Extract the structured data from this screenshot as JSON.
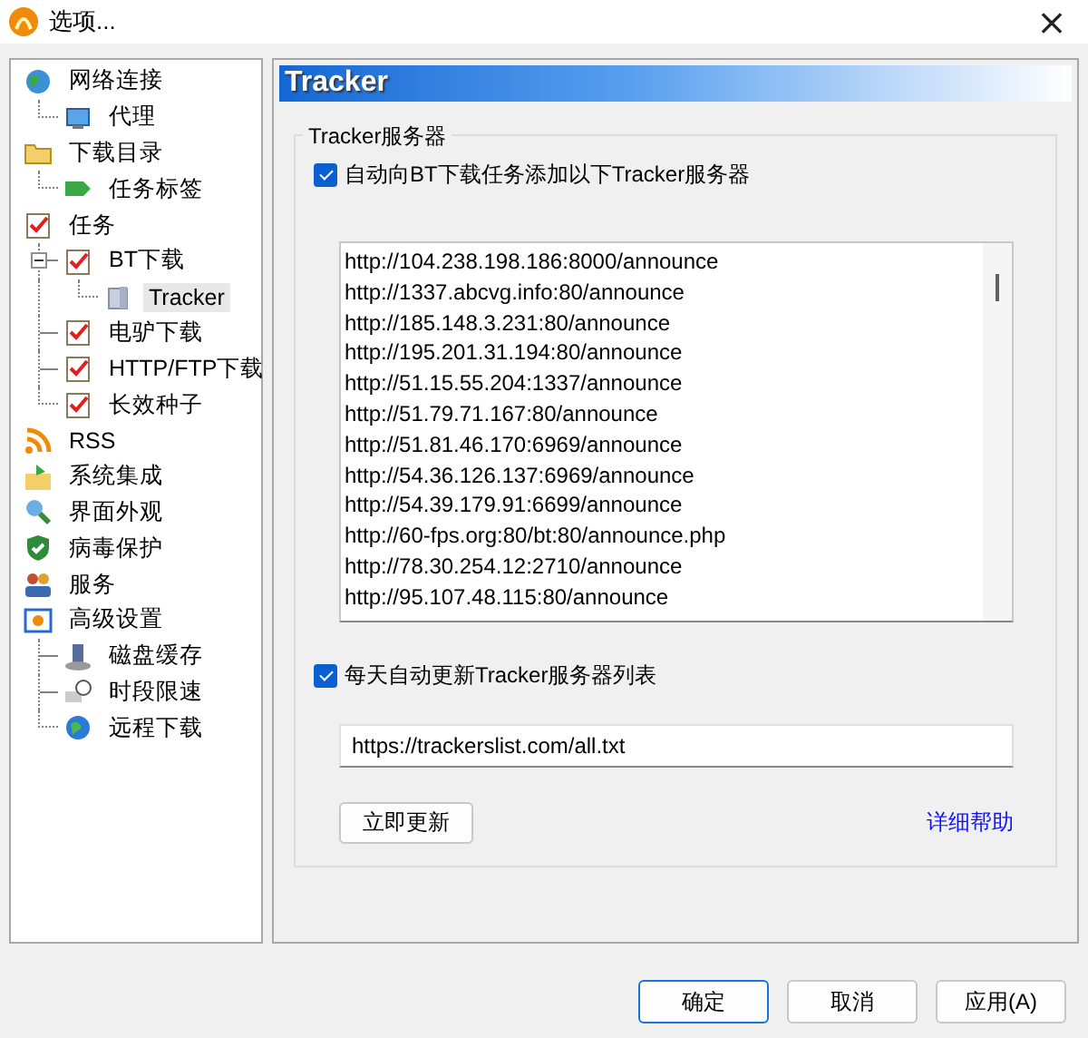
{
  "window": {
    "title": "选项...",
    "close": "×"
  },
  "tree": [
    {
      "label": "网络连接",
      "selected": false,
      "children": [
        {
          "label": "代理",
          "selected": false
        }
      ]
    },
    {
      "label": "下载目录",
      "selected": false,
      "children": [
        {
          "label": "任务标签",
          "selected": false
        }
      ]
    },
    {
      "label": "任务",
      "selected": false,
      "children": [
        {
          "label": "BT下载",
          "selected": false,
          "expanded": true,
          "children": [
            {
              "label": "Tracker",
              "selected": true
            }
          ]
        },
        {
          "label": "电驴下载",
          "selected": false
        },
        {
          "label": "HTTP/FTP下载",
          "selected": false
        },
        {
          "label": "长效种子",
          "selected": false
        }
      ]
    },
    {
      "label": "RSS",
      "selected": false
    },
    {
      "label": "系统集成",
      "selected": false
    },
    {
      "label": "界面外观",
      "selected": false
    },
    {
      "label": "病毒保护",
      "selected": false
    },
    {
      "label": "服务",
      "selected": false
    },
    {
      "label": "高级设置",
      "selected": false,
      "children": [
        {
          "label": "磁盘缓存",
          "selected": false
        },
        {
          "label": "时段限速",
          "selected": false
        },
        {
          "label": "远程下载",
          "selected": false
        }
      ]
    }
  ],
  "page": {
    "title": "Tracker",
    "group": {
      "title": "Tracker服务器",
      "auto_add": {
        "label": "自动向BT下载任务添加以下Tracker服务器",
        "checked": true
      },
      "trackers": [
        "http://104.238.198.186:8000/announce",
        "http://1337.abcvg.info:80/announce",
        "http://185.148.3.231:80/announce",
        "http://195.201.31.194:80/announce",
        "http://51.15.55.204:1337/announce",
        "http://51.79.71.167:80/announce",
        "http://51.81.46.170:6969/announce",
        "http://54.36.126.137:6969/announce",
        "http://54.39.179.91:6699/announce",
        "http://60-fps.org:80/bt:80/announce.php",
        "http://78.30.254.12:2710/announce",
        "http://95.107.48.115:80/announce"
      ],
      "auto_update": {
        "label": "每天自动更新Tracker服务器列表",
        "checked": true
      },
      "url": {
        "value": "https://trackerslist.com/all.txt"
      },
      "update_button": "立即更新",
      "help_link": "详细帮助"
    }
  },
  "buttons": [
    {
      "label": "确定",
      "default": true
    },
    {
      "label": "取消",
      "default": false
    },
    {
      "label": "应用(A)",
      "default": false
    }
  ]
}
